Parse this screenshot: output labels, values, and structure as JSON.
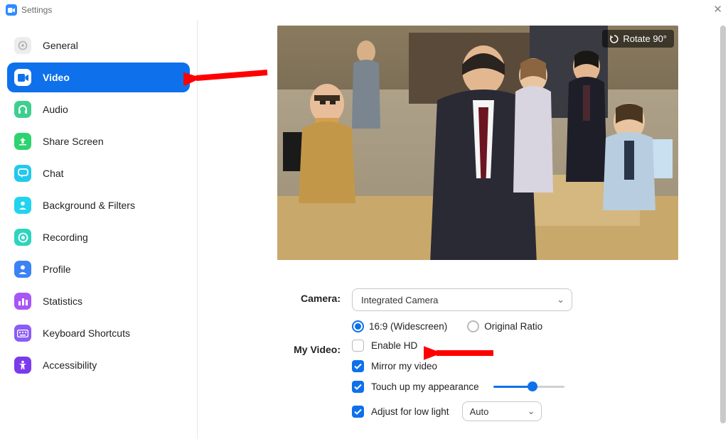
{
  "window": {
    "title": "Settings"
  },
  "sidebar": {
    "items": [
      {
        "label": "General",
        "icon_bg": "#ededed",
        "icon_fg": "#b8b8b8",
        "active": false,
        "name": "sidebar-item-general",
        "icon": "gear"
      },
      {
        "label": "Video",
        "icon_bg": "#ffffff",
        "icon_fg": "#0e71eb",
        "active": true,
        "name": "sidebar-item-video",
        "icon": "video"
      },
      {
        "label": "Audio",
        "icon_bg": "#3ecf8e",
        "icon_fg": "#ffffff",
        "active": false,
        "name": "sidebar-item-audio",
        "icon": "headphones"
      },
      {
        "label": "Share Screen",
        "icon_bg": "#2dd36f",
        "icon_fg": "#ffffff",
        "active": false,
        "name": "sidebar-item-share-screen",
        "icon": "share"
      },
      {
        "label": "Chat",
        "icon_bg": "#23c9ed",
        "icon_fg": "#ffffff",
        "active": false,
        "name": "sidebar-item-chat",
        "icon": "chat"
      },
      {
        "label": "Background & Filters",
        "icon_bg": "#22d3ee",
        "icon_fg": "#ffffff",
        "active": false,
        "name": "sidebar-item-background",
        "icon": "person"
      },
      {
        "label": "Recording",
        "icon_bg": "#2dd4bf",
        "icon_fg": "#ffffff",
        "active": false,
        "name": "sidebar-item-recording",
        "icon": "record"
      },
      {
        "label": "Profile",
        "icon_bg": "#3b82f6",
        "icon_fg": "#ffffff",
        "active": false,
        "name": "sidebar-item-profile",
        "icon": "profile"
      },
      {
        "label": "Statistics",
        "icon_bg": "#a855f7",
        "icon_fg": "#ffffff",
        "active": false,
        "name": "sidebar-item-statistics",
        "icon": "stats"
      },
      {
        "label": "Keyboard Shortcuts",
        "icon_bg": "#8b5cf6",
        "icon_fg": "#ffffff",
        "active": false,
        "name": "sidebar-item-shortcuts",
        "icon": "keyboard"
      },
      {
        "label": "Accessibility",
        "icon_bg": "#7c3aed",
        "icon_fg": "#ffffff",
        "active": false,
        "name": "sidebar-item-accessibility",
        "icon": "accessibility"
      }
    ]
  },
  "preview": {
    "rotate_label": "Rotate 90°"
  },
  "camera": {
    "label": "Camera:",
    "selected": "Integrated Camera",
    "ratio_options": {
      "widescreen": {
        "label": "16:9 (Widescreen)",
        "selected": true
      },
      "original": {
        "label": "Original Ratio",
        "selected": false
      }
    }
  },
  "myvideo": {
    "label": "My Video:",
    "enable_hd": {
      "label": "Enable HD",
      "checked": false
    },
    "mirror": {
      "label": "Mirror my video",
      "checked": true
    },
    "touchup": {
      "label": "Touch up my appearance",
      "checked": true,
      "slider_value": 55
    },
    "lowlight": {
      "label": "Adjust for low light",
      "checked": true,
      "mode": "Auto"
    }
  },
  "colors": {
    "accent": "#0e71eb",
    "arrow": "#ff0000"
  }
}
